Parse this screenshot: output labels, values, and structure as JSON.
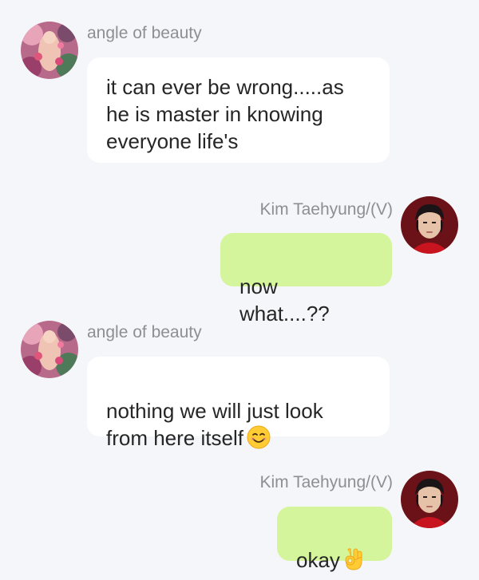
{
  "messages": [
    {
      "direction": "incoming",
      "sender": "angle of beauty",
      "text": "it can ever be wrong.....as\nhe is master in knowing\neveryone life's",
      "avatar": "rose-collage-avatar"
    },
    {
      "direction": "outgoing",
      "sender": "Kim Taehyung/(V)",
      "text": "now what....??",
      "avatar": "portrait-avatar"
    },
    {
      "direction": "incoming",
      "sender": "angle of beauty",
      "text": "nothing we will just look\nfrom here itself",
      "emoji": "smiling-face-emoji",
      "avatar": "rose-collage-avatar"
    },
    {
      "direction": "outgoing",
      "sender": "Kim Taehyung/(V)",
      "text": "okay",
      "emoji": "ok-hand-emoji",
      "avatar": "portrait-avatar"
    }
  ],
  "colors": {
    "background": "#f5f6f9",
    "incoming_bubble": "#ffffff",
    "outgoing_bubble": "#d4f59c",
    "sender_name": "#8e8e93",
    "message_text": "#262626"
  }
}
